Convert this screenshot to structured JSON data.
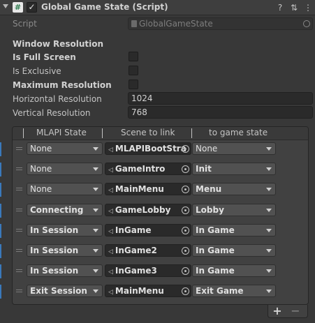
{
  "component": {
    "title": "Global Game State (Script)",
    "enabled_glyph": "✓",
    "script_icon_glyph": "#",
    "icons": [
      "foldout-arrow-icon",
      "help-icon",
      "preset-icon",
      "context-menu-icon"
    ],
    "help_glyph": "?",
    "preset_glyph": "⇅",
    "menu_glyph": "⋮"
  },
  "script": {
    "label": "Script",
    "value": "GlobalGameState"
  },
  "window_resolution": {
    "header": "Window Resolution",
    "is_full_screen_label": "Is Full Screen",
    "is_full_screen": false,
    "is_exclusive_label": "Is Exclusive",
    "is_exclusive": false,
    "maximum_resolution_label": "Maximum Resolution",
    "maximum_resolution": false,
    "horizontal_label": "Horizontal Resolution",
    "horizontal_value": "1024",
    "vertical_label": "Vertical Resolution",
    "vertical_value": "768"
  },
  "list": {
    "columns": [
      "MLAPI State",
      "Scene to link",
      "to game state"
    ],
    "rows": [
      {
        "state": "None",
        "state_bold": false,
        "scene": "MLAPIBootStra",
        "target": "None",
        "target_bold": false
      },
      {
        "state": "None",
        "state_bold": false,
        "scene": "GameIntro",
        "target": "Init",
        "target_bold": true
      },
      {
        "state": "None",
        "state_bold": false,
        "scene": "MainMenu",
        "target": "Menu",
        "target_bold": true
      },
      {
        "state": "Connecting",
        "state_bold": true,
        "scene": "GameLobby",
        "target": "Lobby",
        "target_bold": true
      },
      {
        "state": "In Session",
        "state_bold": true,
        "scene": "InGame",
        "target": "In Game",
        "target_bold": true
      },
      {
        "state": "In Session",
        "state_bold": true,
        "scene": "InGame2",
        "target": "In Game",
        "target_bold": true
      },
      {
        "state": "In Session",
        "state_bold": true,
        "scene": "InGame3",
        "target": "In Game",
        "target_bold": true
      },
      {
        "state": "Exit Session",
        "state_bold": true,
        "scene": "MainMenu",
        "target": "Exit Game",
        "target_bold": true
      }
    ],
    "add_glyph": "+",
    "remove_glyph": "−"
  },
  "colors": {
    "background": "#383838",
    "accent": "#3a79bb",
    "field": "#2a2a2a",
    "dropdown": "#515151"
  }
}
